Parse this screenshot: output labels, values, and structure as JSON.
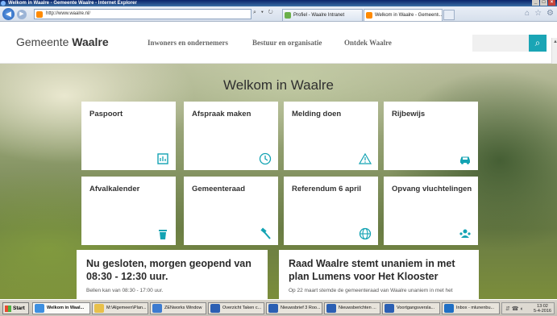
{
  "browser": {
    "window_title": "Welkom in Waalre - Gemeente Waalre - Internet Explorer",
    "address": "http://www.waalre.nl/",
    "tabs": [
      {
        "label": "Profiel - Waalre Intranet"
      },
      {
        "label": "Welkom in Waalre - Gemeent...",
        "close": "×"
      }
    ],
    "back_glyph": "◀",
    "forward_glyph": "▶",
    "addr_tools": "⌕ ▾ ↻",
    "nav_icons": [
      "⌂",
      "☆",
      "⚙"
    ],
    "window_buttons": [
      "_",
      "□",
      "×"
    ],
    "colors": {
      "titlebar": "#0a246a",
      "accent": "#1aa5b5"
    }
  },
  "site": {
    "brand_light": "Gemeente ",
    "brand_bold": "Waalre",
    "nav": [
      "Inwoners en ondernemers",
      "Bestuur en organisatie",
      "Ontdek Waalre"
    ],
    "search_icon": "⌕",
    "hero_title": "Welkom in Waalre",
    "tiles": [
      {
        "label": "Paspoort",
        "icon": "passport-icon"
      },
      {
        "label": "Afspraak maken",
        "icon": "clock-icon"
      },
      {
        "label": "Melding doen",
        "icon": "warning-icon"
      },
      {
        "label": "Rijbewijs",
        "icon": "car-icon"
      },
      {
        "label": "Afvalkalender",
        "icon": "trash-icon"
      },
      {
        "label": "Gemeenteraad",
        "icon": "gavel-icon"
      },
      {
        "label": "Referendum 6 april",
        "icon": "globe-icon"
      },
      {
        "label": "Opvang vluchtelingen",
        "icon": "people-icon"
      }
    ],
    "news": [
      {
        "title": "Nu gesloten, morgen geopend van 08:30 - 12:30 uur.",
        "text": "Bellen kan van 08:30 - 17:00 uur."
      },
      {
        "title": "Raad Waalre stemt unaniem in met plan Lumens voor Het Klooster",
        "text": "Op 22 maart stemde de gemeenteraad van Waalre unaniem in met het"
      }
    ]
  },
  "taskbar": {
    "start": "Start",
    "buttons": [
      {
        "label": "Welkom in Waal...",
        "active": true
      },
      {
        "label": "M:\\Algemeen\\Plan..."
      },
      {
        "label": "ZENworks Window"
      },
      {
        "label": "Overzicht Taken c..."
      },
      {
        "label": "Nieuwsbrief 3 Roo..."
      },
      {
        "label": "Nieuwsberichten ..."
      },
      {
        "label": "Voortgangsversla..."
      },
      {
        "label": "Inbox - mlunenbu..."
      }
    ],
    "tray_icons": "⇵ ☎ ◐",
    "time": "13:02",
    "date": "5-4-2016"
  }
}
